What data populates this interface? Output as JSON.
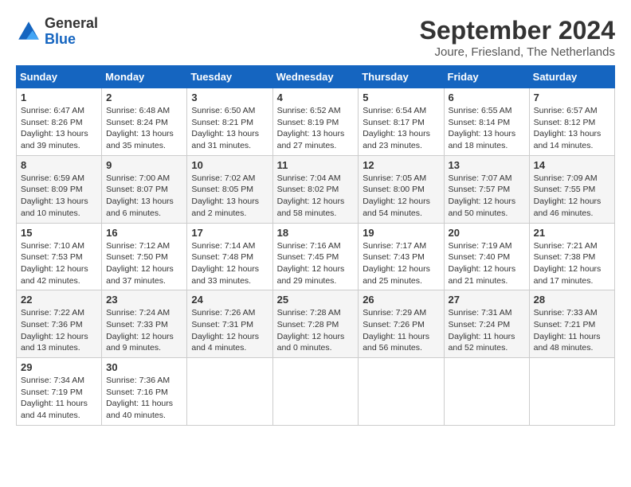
{
  "header": {
    "logo": {
      "general": "General",
      "blue": "Blue"
    },
    "title": "September 2024",
    "subtitle": "Joure, Friesland, The Netherlands"
  },
  "calendar": {
    "days_of_week": [
      "Sunday",
      "Monday",
      "Tuesday",
      "Wednesday",
      "Thursday",
      "Friday",
      "Saturday"
    ],
    "weeks": [
      [
        null,
        {
          "day": "2",
          "sunrise": "6:48 AM",
          "sunset": "8:24 PM",
          "daylight": "13 hours and 35 minutes."
        },
        {
          "day": "3",
          "sunrise": "6:50 AM",
          "sunset": "8:21 PM",
          "daylight": "13 hours and 31 minutes."
        },
        {
          "day": "4",
          "sunrise": "6:52 AM",
          "sunset": "8:19 PM",
          "daylight": "13 hours and 27 minutes."
        },
        {
          "day": "5",
          "sunrise": "6:54 AM",
          "sunset": "8:17 PM",
          "daylight": "13 hours and 23 minutes."
        },
        {
          "day": "6",
          "sunrise": "6:55 AM",
          "sunset": "8:14 PM",
          "daylight": "13 hours and 18 minutes."
        },
        {
          "day": "7",
          "sunrise": "6:57 AM",
          "sunset": "8:12 PM",
          "daylight": "13 hours and 14 minutes."
        }
      ],
      [
        {
          "day": "1",
          "sunrise": "6:47 AM",
          "sunset": "8:26 PM",
          "daylight": "13 hours and 39 minutes."
        },
        null,
        null,
        null,
        null,
        null,
        null
      ],
      [
        {
          "day": "8",
          "sunrise": "6:59 AM",
          "sunset": "8:09 PM",
          "daylight": "13 hours and 10 minutes."
        },
        {
          "day": "9",
          "sunrise": "7:00 AM",
          "sunset": "8:07 PM",
          "daylight": "13 hours and 6 minutes."
        },
        {
          "day": "10",
          "sunrise": "7:02 AM",
          "sunset": "8:05 PM",
          "daylight": "13 hours and 2 minutes."
        },
        {
          "day": "11",
          "sunrise": "7:04 AM",
          "sunset": "8:02 PM",
          "daylight": "12 hours and 58 minutes."
        },
        {
          "day": "12",
          "sunrise": "7:05 AM",
          "sunset": "8:00 PM",
          "daylight": "12 hours and 54 minutes."
        },
        {
          "day": "13",
          "sunrise": "7:07 AM",
          "sunset": "7:57 PM",
          "daylight": "12 hours and 50 minutes."
        },
        {
          "day": "14",
          "sunrise": "7:09 AM",
          "sunset": "7:55 PM",
          "daylight": "12 hours and 46 minutes."
        }
      ],
      [
        {
          "day": "15",
          "sunrise": "7:10 AM",
          "sunset": "7:53 PM",
          "daylight": "12 hours and 42 minutes."
        },
        {
          "day": "16",
          "sunrise": "7:12 AM",
          "sunset": "7:50 PM",
          "daylight": "12 hours and 37 minutes."
        },
        {
          "day": "17",
          "sunrise": "7:14 AM",
          "sunset": "7:48 PM",
          "daylight": "12 hours and 33 minutes."
        },
        {
          "day": "18",
          "sunrise": "7:16 AM",
          "sunset": "7:45 PM",
          "daylight": "12 hours and 29 minutes."
        },
        {
          "day": "19",
          "sunrise": "7:17 AM",
          "sunset": "7:43 PM",
          "daylight": "12 hours and 25 minutes."
        },
        {
          "day": "20",
          "sunrise": "7:19 AM",
          "sunset": "7:40 PM",
          "daylight": "12 hours and 21 minutes."
        },
        {
          "day": "21",
          "sunrise": "7:21 AM",
          "sunset": "7:38 PM",
          "daylight": "12 hours and 17 minutes."
        }
      ],
      [
        {
          "day": "22",
          "sunrise": "7:22 AM",
          "sunset": "7:36 PM",
          "daylight": "12 hours and 13 minutes."
        },
        {
          "day": "23",
          "sunrise": "7:24 AM",
          "sunset": "7:33 PM",
          "daylight": "12 hours and 9 minutes."
        },
        {
          "day": "24",
          "sunrise": "7:26 AM",
          "sunset": "7:31 PM",
          "daylight": "12 hours and 4 minutes."
        },
        {
          "day": "25",
          "sunrise": "7:28 AM",
          "sunset": "7:28 PM",
          "daylight": "12 hours and 0 minutes."
        },
        {
          "day": "26",
          "sunrise": "7:29 AM",
          "sunset": "7:26 PM",
          "daylight": "11 hours and 56 minutes."
        },
        {
          "day": "27",
          "sunrise": "7:31 AM",
          "sunset": "7:24 PM",
          "daylight": "11 hours and 52 minutes."
        },
        {
          "day": "28",
          "sunrise": "7:33 AM",
          "sunset": "7:21 PM",
          "daylight": "11 hours and 48 minutes."
        }
      ],
      [
        {
          "day": "29",
          "sunrise": "7:34 AM",
          "sunset": "7:19 PM",
          "daylight": "11 hours and 44 minutes."
        },
        {
          "day": "30",
          "sunrise": "7:36 AM",
          "sunset": "7:16 PM",
          "daylight": "11 hours and 40 minutes."
        },
        null,
        null,
        null,
        null,
        null
      ]
    ]
  }
}
